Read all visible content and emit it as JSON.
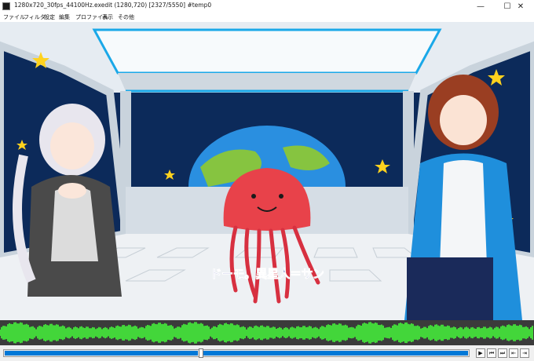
{
  "window": {
    "title": "1280x720_30fps_44100Hz.exedit (1280,720)  [2327/5550]  #temp0",
    "minimize_glyph": "—",
    "maximize_glyph": "☐",
    "close_glyph": "✕"
  },
  "menu": {
    "items": [
      {
        "label": "ファイル"
      },
      {
        "label": "フィルタ"
      },
      {
        "label": "設定"
      },
      {
        "label": "編集"
      },
      {
        "label": "プロファイル"
      },
      {
        "label": "表示"
      },
      {
        "label": "その他"
      }
    ]
  },
  "preview": {
    "subtitle": "ドーモ。異星人＝サン"
  },
  "playback": {
    "current_frame": 2327,
    "total_frames": 5550,
    "controls": [
      {
        "name": "play-button",
        "glyph": "▶"
      },
      {
        "name": "frame-start-button",
        "glyph": "⏮"
      },
      {
        "name": "frame-end-button",
        "glyph": "⏭"
      },
      {
        "name": "prev-frame-button",
        "glyph": "⇤"
      },
      {
        "name": "next-frame-button",
        "glyph": "⇥"
      }
    ]
  },
  "colors": {
    "waveform": "#43d63a",
    "seek_accent": "#0078d7",
    "subtitle": "#1b2ea0"
  }
}
